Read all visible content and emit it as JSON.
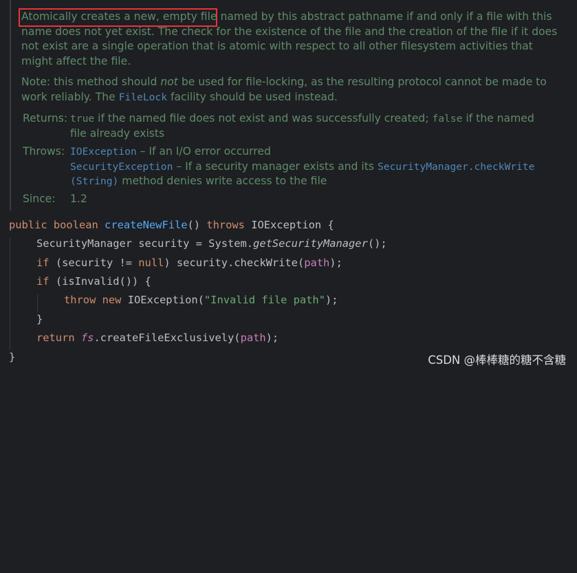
{
  "doc": {
    "p1_highlight": "Atomically creates a new, empty file",
    "p1_rest": " named by this abstract pathname if and only if a file with this name does not yet exist. The check for the existence of the file and the creation of the file if it does not exist are a single operation that is atomic with respect to all other filesystem activities that might affect the file.",
    "p2_a": "Note: this method should ",
    "p2_em": "not",
    "p2_b": " be used for file-locking, as the resulting protocol cannot be made to work reliably. The ",
    "p2_link": "FileLock",
    "p2_c": " facility should be used instead.",
    "returns_label": "Returns:",
    "returns_true": "true",
    "returns_mid": " if the named file does not exist and was successfully created; ",
    "returns_false": "false",
    "returns_end": " if the named file already exists",
    "throws_label": "Throws:",
    "throws_ex1": "IOException",
    "throws_ex1_desc": " – If an I/O error occurred",
    "throws_ex2": "SecurityException",
    "throws_ex2_desc": " – If a security manager exists and its ",
    "throws_ex2_link": "SecurityManager.checkWrite",
    "throws_ex2_link2": "(String)",
    "throws_ex2_end": " method denies write access to the file",
    "since_label": "Since:",
    "since_value": "1.2"
  },
  "code": {
    "l1_public": "public",
    "l1_boolean": "boolean",
    "l1_name": "createNewFile",
    "l1_parens": "()",
    "l1_throws": "throws",
    "l1_type": "IOException {",
    "l2_a": "SecurityManager security = System.",
    "l2_b": "getSecurityManager",
    "l2_c": "();",
    "l3_if": "if",
    "l3_a": " (security != ",
    "l3_null": "null",
    "l3_b": ") security.checkWrite(",
    "l3_path": "path",
    "l3_c": ");",
    "l4_if": "if",
    "l4_a": " (isInvalid()) {",
    "l5_throw": "throw",
    "l5_new": "new",
    "l5_a": " IOException(",
    "l5_str": "\"Invalid file path\"",
    "l5_b": ");",
    "l6": "}",
    "l7_return": "return",
    "l7_fs": "fs",
    "l7_a": ".createFileExclusively(",
    "l7_path": "path",
    "l7_b": ");",
    "l8": "}"
  },
  "watermark": "CSDN @棒棒糖的糖不含糖",
  "colors": {
    "background": "#1e1f22",
    "doc_text": "#5f8b6a",
    "keyword": "#cf8e6d",
    "function": "#56a8f5",
    "string": "#6aab73",
    "field": "#c77dbb",
    "highlight_box": "#e8343a"
  }
}
